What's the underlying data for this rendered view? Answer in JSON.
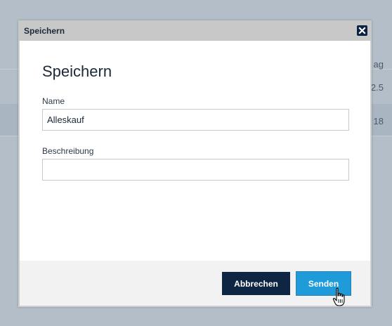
{
  "background": {
    "header_fragment": "ag",
    "row1_value": "2.5",
    "row2_value": "18"
  },
  "dialog": {
    "titlebar_title": "Speichern",
    "heading": "Speichern",
    "name_label": "Name",
    "name_value": "Alleskauf",
    "description_label": "Beschreibung",
    "description_value": "",
    "cancel_label": "Abbrechen",
    "submit_label": "Senden"
  },
  "colors": {
    "overlay": "#b3bec8",
    "titlebar": "#c8c8c8",
    "cancel_button": "#0e2644",
    "submit_button": "#1e9bd8",
    "footer": "#f2f2f2"
  },
  "icons": {
    "close": "close-icon",
    "cursor": "hand-pointer-icon"
  }
}
